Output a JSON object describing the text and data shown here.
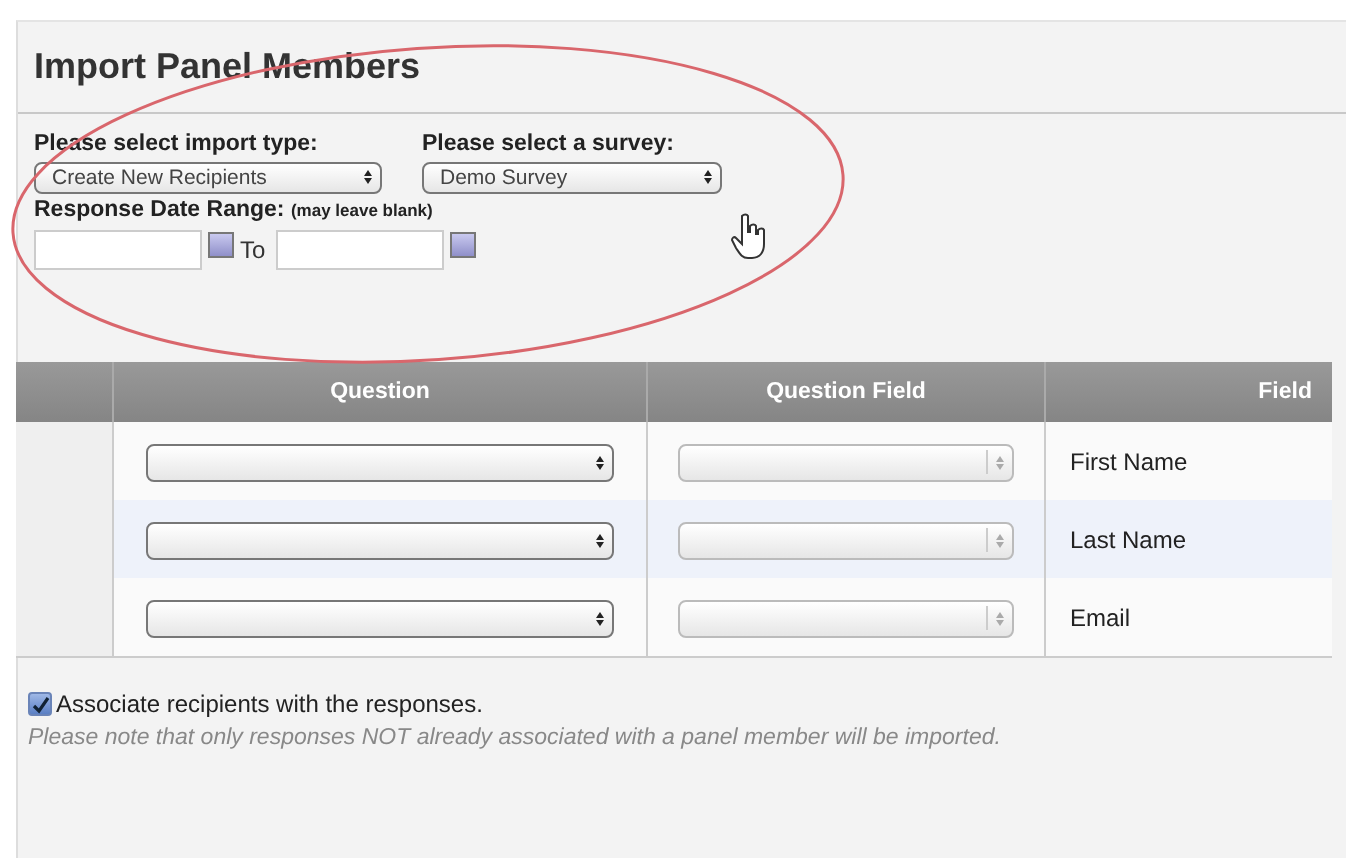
{
  "title": "Import Panel Members",
  "import_type": {
    "label": "Please select import type:",
    "value": "Create New Recipients"
  },
  "survey": {
    "label": "Please select a survey:",
    "value": "Demo Survey"
  },
  "date_range": {
    "label": "Response Date Range:",
    "hint": "(may leave blank)",
    "to_label": "To"
  },
  "table": {
    "columns": [
      "Question",
      "Question Field",
      "Field"
    ],
    "rows": [
      {
        "question_disabled": false,
        "question_field_disabled": true,
        "field": "First Name"
      },
      {
        "question_disabled": false,
        "question_field_disabled": true,
        "field": "Last Name"
      },
      {
        "question_disabled": false,
        "question_field_disabled": true,
        "field": "Email"
      }
    ]
  },
  "associate": {
    "checked": true,
    "label": "Associate recipients with the responses."
  },
  "note": "Please note that only responses NOT already associated with a panel member will be imported."
}
